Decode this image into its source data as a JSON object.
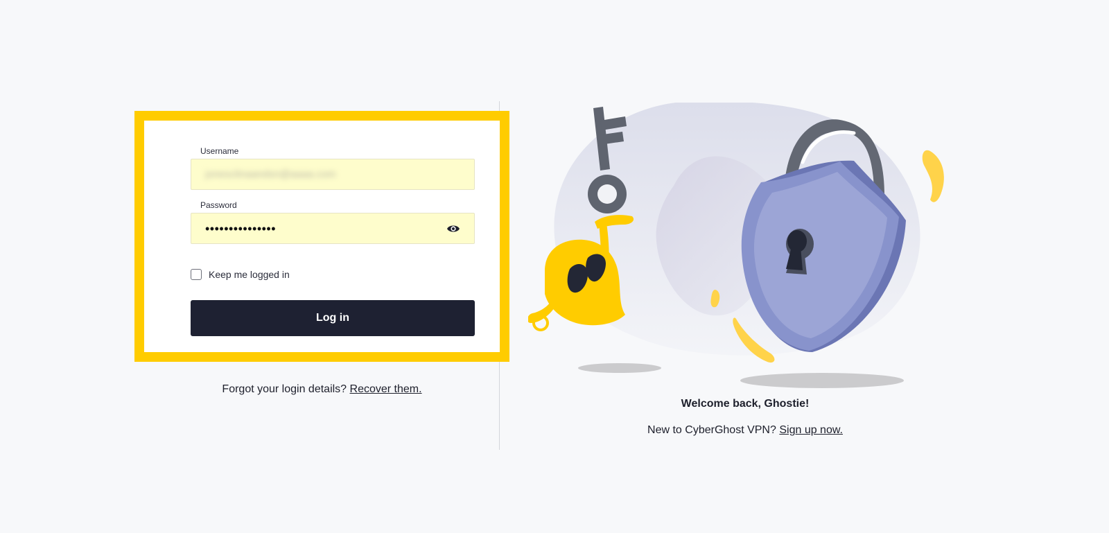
{
  "login": {
    "username_label": "Username",
    "username_value": "jonesclinaandsn@aaaa.com",
    "password_label": "Password",
    "password_value": "•••••••••••••••",
    "remember_label": "Keep me logged in",
    "remember_checked": false,
    "submit_label": "Log in"
  },
  "recovery": {
    "prompt": "Forgot your login details?",
    "link": "Recover them."
  },
  "welcome": {
    "title": "Welcome back, Ghostie!",
    "signup_prompt": "New to CyberGhost VPN?",
    "signup_link": "Sign up now."
  },
  "colors": {
    "accent": "#ffcc00",
    "button": "#1e2132",
    "field_background": "#fefdcc",
    "page_background": "#f7f8fa",
    "lock": "#7f8bc6"
  },
  "icons": {
    "password_toggle": "eye-icon",
    "illustration": "ghost-with-key-and-shield-lock"
  }
}
